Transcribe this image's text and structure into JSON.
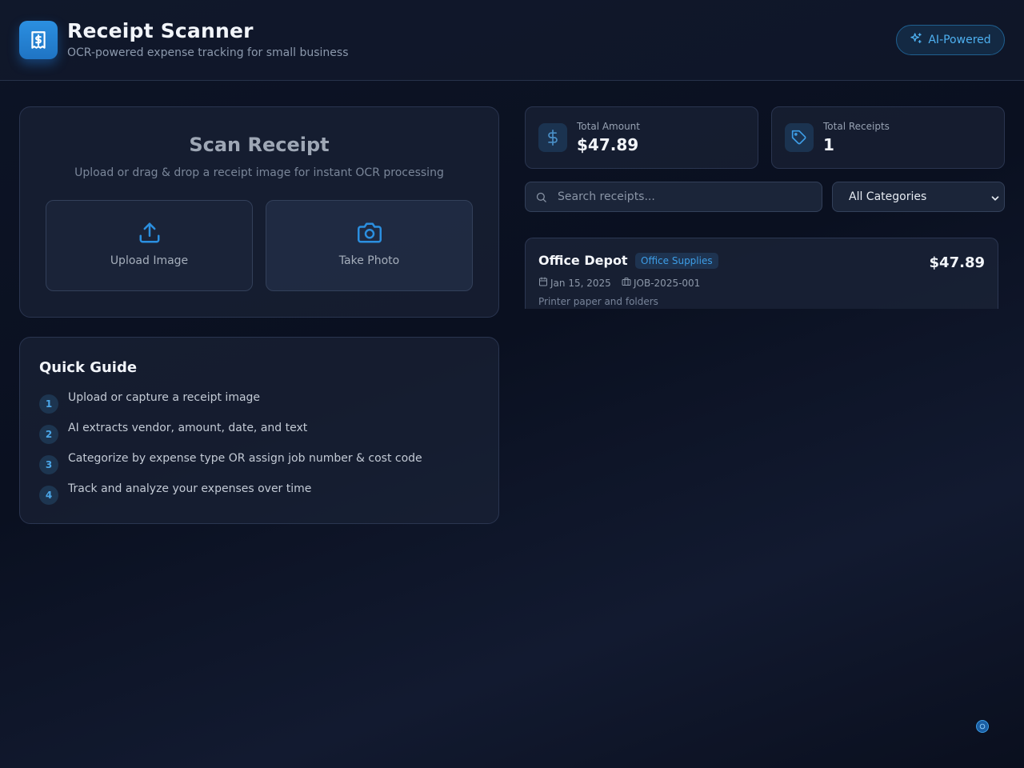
{
  "header": {
    "title": "Receipt Scanner",
    "subtitle": "OCR-powered expense tracking for small business",
    "badge": "AI-Powered"
  },
  "scan": {
    "title": "Scan Receipt",
    "description": "Upload or drag & drop a receipt image for instant OCR processing",
    "upload_label": "Upload Image",
    "photo_label": "Take Photo"
  },
  "guide": {
    "title": "Quick Guide",
    "steps": [
      {
        "num": "1",
        "text": "Upload or capture a receipt image"
      },
      {
        "num": "2",
        "text": "AI extracts vendor, amount, date, and text"
      },
      {
        "num": "3",
        "text": "Categorize by expense type OR assign job number & cost code"
      },
      {
        "num": "4",
        "text": "Track and analyze your expenses over time"
      }
    ]
  },
  "stats": {
    "total_amount_label": "Total Amount",
    "total_amount": "$47.89",
    "total_receipts_label": "Total Receipts",
    "total_receipts": "1"
  },
  "search": {
    "placeholder": "Search receipts...",
    "value": ""
  },
  "filter": {
    "selected": "All Categories"
  },
  "receipts": [
    {
      "vendor": "Office Depot",
      "category": "Office Supplies",
      "amount": "$47.89",
      "date": "Jan 15, 2025",
      "job": "JOB-2025-001",
      "note": "Printer paper and folders"
    }
  ],
  "colors": {
    "accent": "#2b8fe0",
    "accent_text": "#4eb0f0",
    "background": "#0b1222"
  },
  "icons": {
    "logo": "receipt-dollar-icon",
    "badge": "sparkles-icon",
    "upload": "upload-icon",
    "photo": "camera-icon",
    "amount": "dollar-icon",
    "receipts": "tag-icon",
    "search": "search-icon",
    "date": "calendar-icon",
    "job": "briefcase-icon"
  }
}
